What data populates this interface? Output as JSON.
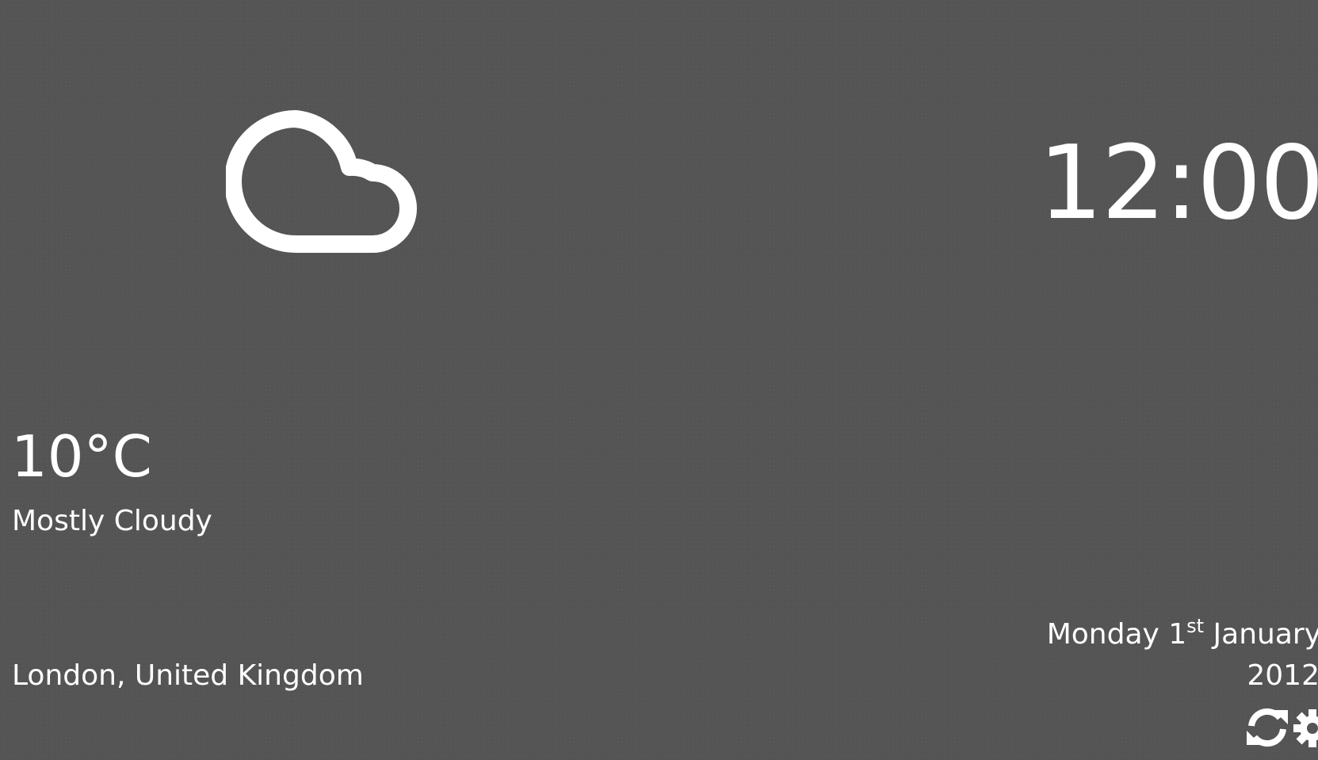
{
  "weather": {
    "icon": "cloud-icon",
    "temperature": "10°C",
    "condition": "Mostly Cloudy",
    "location": "London, United Kingdom"
  },
  "clock": {
    "time": "12:00"
  },
  "date": {
    "prefix": "Monday 1",
    "ordinal_suffix": "st",
    "month": " January",
    "year": "2012"
  },
  "controls": {
    "refresh_icon": "refresh-icon",
    "settings_icon": "gear-icon"
  },
  "colors": {
    "background": "#555555",
    "text": "#ffffff"
  }
}
